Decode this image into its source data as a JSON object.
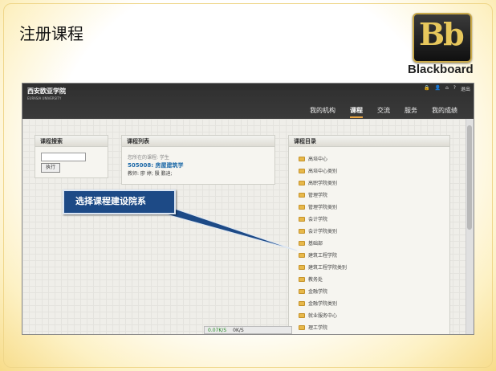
{
  "slide": {
    "title": "注册课程"
  },
  "logo": {
    "mark": "Bb",
    "word": "Blackboard"
  },
  "portal": {
    "school_name": "西安欧亚学院",
    "school_sub": "EURASIA UNIVERSITY",
    "utils": [
      "退出"
    ],
    "nav": [
      "我的机构",
      "课程",
      "交流",
      "服务",
      "我的成绩"
    ],
    "active_nav": "课程"
  },
  "search_module": {
    "title": "课程搜索",
    "input_value": "",
    "button": "执行"
  },
  "course_list_module": {
    "title": "课程列表",
    "role_line": "您所在的课程: 学生",
    "course_link": "505008: 房屋建筑学",
    "teacher_line": "教师: 廖 婷; 殷 鹏迪;"
  },
  "catalog_module": {
    "title": "课程目录",
    "items": [
      "高培中心",
      "高培中心类别",
      "高职学院类别",
      "管理学院",
      "管理学院类别",
      "会计学院",
      "会计学院类别",
      "基础部",
      "建筑工程学院",
      "建筑工程学院类别",
      "教务处",
      "金融学院",
      "金融学院类别",
      "就业服务中心",
      "理工学院"
    ]
  },
  "status_bar": {
    "download": "0.07K/S",
    "upload": "0K/S"
  },
  "callout": {
    "text": "选择课程建设院系"
  }
}
